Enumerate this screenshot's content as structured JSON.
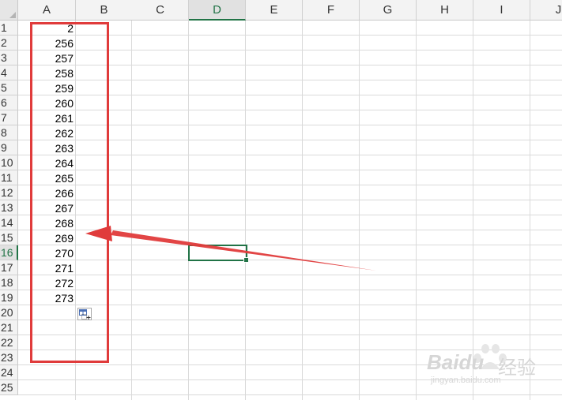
{
  "columns": [
    "A",
    "B",
    "C",
    "D",
    "E",
    "F",
    "G",
    "H",
    "I",
    "J"
  ],
  "rows": [
    "1",
    "2",
    "3",
    "4",
    "5",
    "6",
    "7",
    "8",
    "9",
    "10",
    "11",
    "12",
    "13",
    "14",
    "15",
    "16",
    "17",
    "18",
    "19",
    "20",
    "21",
    "22",
    "23",
    "24",
    "25"
  ],
  "active_column": "D",
  "active_row": "16",
  "column_a_values": [
    "2",
    "256",
    "257",
    "258",
    "259",
    "260",
    "261",
    "262",
    "263",
    "264",
    "265",
    "266",
    "267",
    "268",
    "269",
    "270",
    "271",
    "272",
    "273"
  ],
  "watermark": {
    "brand": "Baidu",
    "brand_cn": "经验",
    "url": "jingyan.baidu.com"
  },
  "colors": {
    "accent_green": "#217346",
    "annotation_red": "#e03b3b",
    "grid": "#dadada"
  },
  "icons": [
    "auto-fill-options-icon",
    "red-arrow-annotation"
  ]
}
